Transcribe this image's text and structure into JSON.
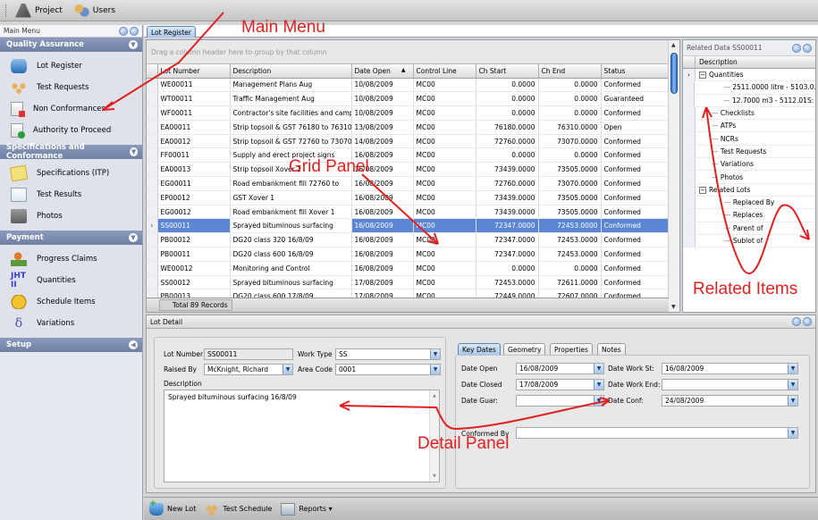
{
  "toolbar": {
    "items": [
      {
        "label": "Project",
        "icon": "road-icon"
      },
      {
        "label": "Users",
        "icon": "users-icon"
      }
    ]
  },
  "sidebar": {
    "title": "Main Menu",
    "sections": [
      {
        "label": "Quality Assurance",
        "expanded": true,
        "items": [
          {
            "label": "Lot Register",
            "icon": "database-icon"
          },
          {
            "label": "Test Requests",
            "icon": "test-requests-icon"
          },
          {
            "label": "Non Conformances",
            "icon": "document-error-icon"
          },
          {
            "label": "Authority to Proceed",
            "icon": "document-approved-icon"
          }
        ]
      },
      {
        "label": "Specifications and Conformance",
        "expanded": true,
        "items": [
          {
            "label": "Specifications (ITP)",
            "icon": "notepad-icon"
          },
          {
            "label": "Test Results",
            "icon": "test-results-icon"
          },
          {
            "label": "Photos",
            "icon": "camera-icon"
          }
        ]
      },
      {
        "label": "Payment",
        "expanded": true,
        "items": [
          {
            "label": "Progress Claims",
            "icon": "progress-claims-icon"
          },
          {
            "label": "Quantities",
            "icon": "tally-icon",
            "glyph": "JHT II"
          },
          {
            "label": "Schedule Items",
            "icon": "coin-icon"
          },
          {
            "label": "Variations",
            "icon": "delta-icon",
            "glyph": "δ"
          }
        ]
      },
      {
        "label": "Setup",
        "expanded": false,
        "items": []
      }
    ]
  },
  "main_tab": {
    "label": "Lot Register"
  },
  "grid": {
    "group_hint": "Drag a column header here to group by that column",
    "columns": [
      "Lot Number",
      "Description",
      "Date Open",
      "Control Line",
      "Ch Start",
      "Ch End",
      "Status"
    ],
    "sort_indicator": "▲",
    "sorted_column": "Date Open",
    "rows": [
      {
        "lot": "WE00011",
        "desc": "Management Plans Aug",
        "date": "10/08/2009",
        "cl": "MC00",
        "start": "0.0000",
        "end": "0.0000",
        "status": "Conformed"
      },
      {
        "lot": "WT00011",
        "desc": "Traffic Management Aug",
        "date": "10/08/2009",
        "cl": "MC00",
        "start": "0.0000",
        "end": "0.0000",
        "status": "Guaranteed"
      },
      {
        "lot": "WF00011",
        "desc": "Contractor's site facilities and camp",
        "date": "10/08/2009",
        "cl": "MC00",
        "start": "0.0000",
        "end": "0.0000",
        "status": "Conformed"
      },
      {
        "lot": "EA00011",
        "desc": "Strip topsoil & GST 76180 to 76310",
        "date": "13/08/2009",
        "cl": "MC00",
        "start": "76180.0000",
        "end": "76310.0000",
        "status": "Open"
      },
      {
        "lot": "EA00012",
        "desc": "Strip topsoil & GST 72760 to 73070",
        "date": "14/08/2009",
        "cl": "MC00",
        "start": "72760.0000",
        "end": "73070.0000",
        "status": "Conformed"
      },
      {
        "lot": "FF00011",
        "desc": "Supply and erect project signs",
        "date": "16/08/2009",
        "cl": "MC00",
        "start": "0.0000",
        "end": "0.0000",
        "status": "Conformed"
      },
      {
        "lot": "EA00013",
        "desc": "Strip topsoil Xover 1",
        "date": "16/08/2009",
        "cl": "MC00",
        "start": "73439.0000",
        "end": "73505.0000",
        "status": "Conformed"
      },
      {
        "lot": "EG00011",
        "desc": "Road embankment fill 72760 to",
        "date": "16/08/2009",
        "cl": "MC00",
        "start": "72760.0000",
        "end": "73070.0000",
        "status": "Conformed"
      },
      {
        "lot": "EP00012",
        "desc": "GST Xover 1",
        "date": "16/08/2009",
        "cl": "MC00",
        "start": "73439.0000",
        "end": "73505.0000",
        "status": "Conformed"
      },
      {
        "lot": "EG00012",
        "desc": "Road embankment fill Xover 1",
        "date": "16/08/2009",
        "cl": "MC00",
        "start": "73439.0000",
        "end": "73505.0000",
        "status": "Conformed"
      },
      {
        "lot": "SS00011",
        "desc": "Sprayed bituminous surfacing",
        "date": "16/08/2009",
        "cl": "MC00",
        "start": "72347.0000",
        "end": "72453.0000",
        "status": "Conformed",
        "selected": true
      },
      {
        "lot": "PB00012",
        "desc": "DG20 class 320 16/8/09",
        "date": "16/08/2009",
        "cl": "MC00",
        "start": "72347.0000",
        "end": "72453.0000",
        "status": "Conformed"
      },
      {
        "lot": "PB00011",
        "desc": "DG20 class 600 16/8/09",
        "date": "16/08/2009",
        "cl": "MC00",
        "start": "72347.0000",
        "end": "72453.0000",
        "status": "Conformed"
      },
      {
        "lot": "WE00012",
        "desc": "Monitoring and Control",
        "date": "16/08/2009",
        "cl": "MC00",
        "start": "0.0000",
        "end": "0.0000",
        "status": "Conformed"
      },
      {
        "lot": "SS00012",
        "desc": "Sprayed bituminous surfacing",
        "date": "17/08/2009",
        "cl": "MC00",
        "start": "72453.0000",
        "end": "72611.0000",
        "status": "Conformed"
      },
      {
        "lot": "PB00013",
        "desc": "DG20 class 600 17/8/09",
        "date": "17/08/2009",
        "cl": "MC00",
        "start": "72449.0000",
        "end": "72607.0000",
        "status": "Conformed"
      }
    ],
    "footer": "Total 89 Records",
    "row_indicator": "›"
  },
  "related": {
    "title": "Related Data SS00011",
    "column": "Description",
    "tree": [
      {
        "label": "Quantities",
        "level": 0,
        "expander": "−",
        "current": true
      },
      {
        "label": "2511.0000 litre - 5103.0...",
        "level": 1
      },
      {
        "label": "12.7000 m3 - 5112.01S: ...",
        "level": 1
      },
      {
        "label": "Checklists",
        "level": 0
      },
      {
        "label": "ATPs",
        "level": 0
      },
      {
        "label": "NCRs",
        "level": 0
      },
      {
        "label": "Test Requests",
        "level": 0
      },
      {
        "label": "Variations",
        "level": 0
      },
      {
        "label": "Photos",
        "level": 0
      },
      {
        "label": "Related Lots",
        "level": 0,
        "expander": "−"
      },
      {
        "label": "Replaced By",
        "level": 1
      },
      {
        "label": "Replaces",
        "level": 1
      },
      {
        "label": "Parent of",
        "level": 1
      },
      {
        "label": "Sublot of",
        "level": 1
      }
    ]
  },
  "detail": {
    "title": "Lot Detail",
    "lot_number_label": "Lot Number",
    "lot_number": "SS00011",
    "work_type_label": "Work Type",
    "work_type": "SS",
    "raised_by_label": "Raised By",
    "raised_by": "McKnight, Richard",
    "area_code_label": "Area Code",
    "area_code": "0001",
    "description_label": "Description",
    "description": "Sprayed bituminous surfacing 16/8/09",
    "tabs": [
      "Key Dates",
      "Geometry",
      "Properties",
      "Notes"
    ],
    "active_tab": "Key Dates",
    "date_open_label": "Date Open",
    "date_open": "16/08/2009",
    "date_closed_label": "Date Closed",
    "date_closed": "17/08/2009",
    "date_guar_label": "Date Guar:",
    "date_guar": "",
    "date_work_st_label": "Date Work St:",
    "date_work_st": "16/08/2009",
    "date_work_end_label": "Date Work End:",
    "date_work_end": "",
    "date_conf_label": "Date Conf:",
    "date_conf": "24/08/2009",
    "conformed_by_label": "Conformed By",
    "conformed_by": ""
  },
  "bottom_toolbar": {
    "new_lot": "New Lot",
    "test_schedule": "Test Schedule",
    "reports": "Reports ▾"
  },
  "annotations": {
    "main_menu": "Main Menu",
    "grid_panel": "Grid Panel",
    "related_items": "Related Items",
    "detail_panel": "Detail Panel",
    "color": "#e02020"
  },
  "colors": {
    "selection": "#5b86d6",
    "section_header": "#7a89ad",
    "accent_blue": "#2f6fc8"
  }
}
